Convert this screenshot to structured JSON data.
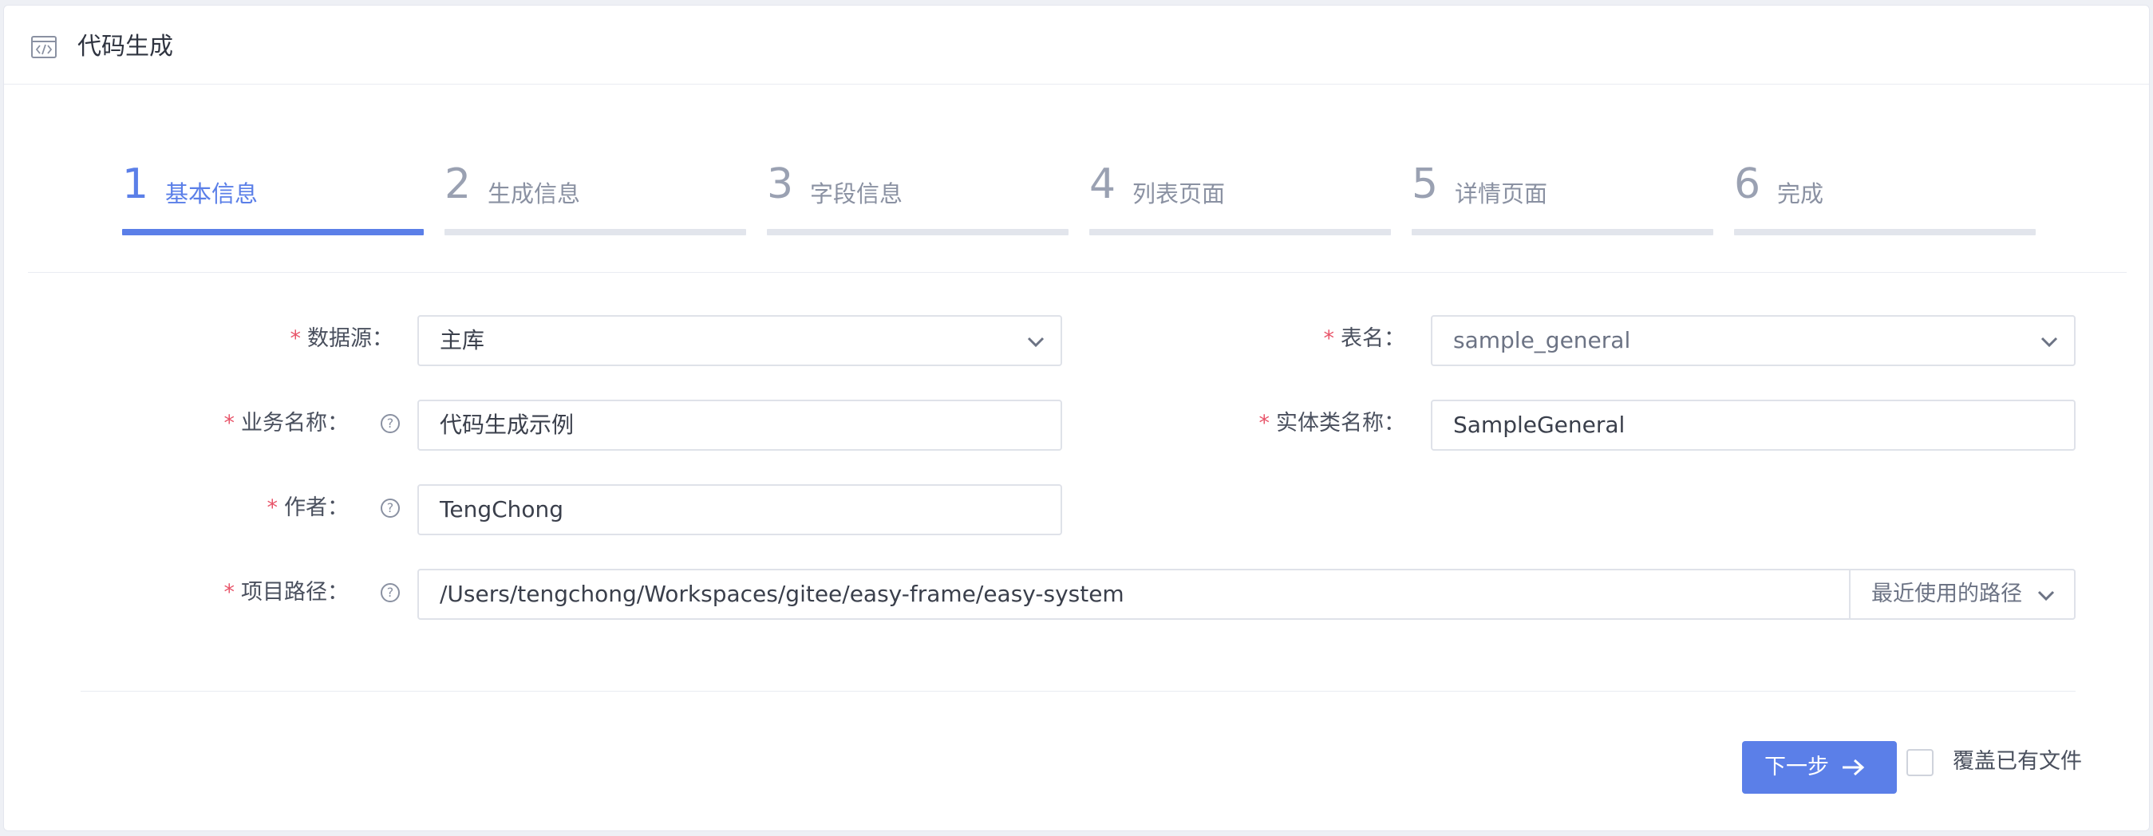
{
  "header": {
    "title": "代码生成",
    "icon": "code-window-icon"
  },
  "steps": [
    {
      "num": "1",
      "label": "基本信息",
      "active": true
    },
    {
      "num": "2",
      "label": "生成信息",
      "active": false
    },
    {
      "num": "3",
      "label": "字段信息",
      "active": false
    },
    {
      "num": "4",
      "label": "列表页面",
      "active": false
    },
    {
      "num": "5",
      "label": "详情页面",
      "active": false
    },
    {
      "num": "6",
      "label": "完成",
      "active": false
    }
  ],
  "form": {
    "required_mark": "*",
    "help_mark": "?",
    "datasource": {
      "label": "数据源：",
      "value": "主库"
    },
    "table_name": {
      "label": "表名：",
      "value": "sample_general"
    },
    "business_name": {
      "label": "业务名称：",
      "value": "代码生成示例"
    },
    "entity_name": {
      "label": "实体类名称：",
      "value": "SampleGeneral"
    },
    "author": {
      "label": "作者：",
      "value": "TengChong"
    },
    "project_path": {
      "label": "项目路径：",
      "value": "/Users/tengchong/Workspaces/gitee/easy-frame/easy-system",
      "recent_label": "最近使用的路径"
    }
  },
  "footer": {
    "next_label": "下一步",
    "overwrite_label": "覆盖已有文件",
    "overwrite_checked": false
  },
  "colors": {
    "primary": "#5b7fe8",
    "required": "#e8556a",
    "inactive_bar": "#e2e5ec"
  }
}
